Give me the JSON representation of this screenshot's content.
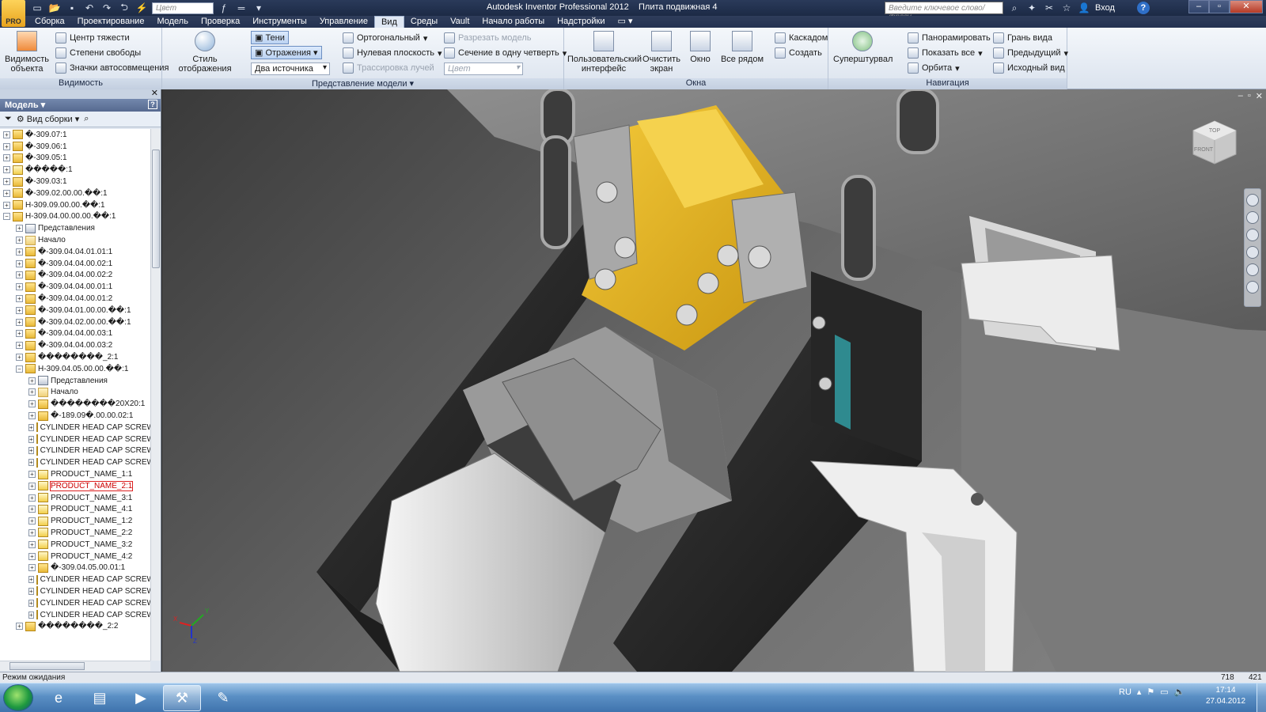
{
  "app": {
    "title": "Autodesk Inventor Professional 2012",
    "document": "Плита подвижная 4",
    "logo_text": "PRO"
  },
  "qat": {
    "color_combo": "Цвет"
  },
  "helpbar": {
    "search_placeholder": "Введите ключевое слово/фразу",
    "login": "Вход",
    "help": "?"
  },
  "menu": {
    "tabs": [
      "Сборка",
      "Проектирование",
      "Модель",
      "Проверка",
      "Инструменты",
      "Управление",
      "Вид",
      "Среды",
      "Vault",
      "Начало работы",
      "Надстройки"
    ],
    "active": "Вид"
  },
  "ribbon": {
    "visibility": {
      "label": "Видимость",
      "big": "Видимость объекта",
      "items": [
        "Центр тяжести",
        "Степени свободы",
        "Значки автосовмещения"
      ]
    },
    "appearance": {
      "label": "Представление модели",
      "style": "Стиль отображения",
      "shadows": "Тени",
      "reflections": "Отражения",
      "lights": "Два источника",
      "ortho": "Ортогональный",
      "ground": "Нулевая плоскость",
      "raytrace": "Трассировка лучей",
      "cut": "Разрезать модель",
      "quarter": "Сечение в одну четверть",
      "color": "Цвет"
    },
    "windows": {
      "label": "Окна",
      "ui": "Пользовательский интерфейс",
      "clean": "Очистить экран",
      "window": "Окно",
      "tile": "Все рядом",
      "cascade": "Каскадом",
      "new": "Создать"
    },
    "navigation": {
      "label": "Навигация",
      "wheel": "Суперштурвал",
      "pan": "Панорамировать",
      "zoomall": "Показать все",
      "orbit": "Орбита",
      "face": "Грань вида",
      "prev": "Предыдущий",
      "home": "Исходный вид"
    }
  },
  "browser": {
    "title": "Модель",
    "view": "Вид сборки",
    "nodes": [
      {
        "d": 0,
        "t": "�-309.07:1",
        "i": "asm",
        "e": "+"
      },
      {
        "d": 0,
        "t": "�-309.06:1",
        "i": "asm",
        "e": "+"
      },
      {
        "d": 0,
        "t": "�-309.05:1",
        "i": "asm",
        "e": "+"
      },
      {
        "d": 0,
        "t": "�����:1",
        "i": "part",
        "e": "+"
      },
      {
        "d": 0,
        "t": "�-309.03:1",
        "i": "asm",
        "e": "+"
      },
      {
        "d": 0,
        "t": "�-309.02.00.00.��:1",
        "i": "asm",
        "e": "+"
      },
      {
        "d": 0,
        "t": "H-309.09.00.00.��:1",
        "i": "asm",
        "e": "+"
      },
      {
        "d": 0,
        "t": "H-309.04.00.00.00.��:1",
        "i": "asm",
        "e": "−"
      },
      {
        "d": 1,
        "t": "Представления",
        "i": "view",
        "e": "+"
      },
      {
        "d": 1,
        "t": "Начало",
        "i": "folder",
        "e": "+"
      },
      {
        "d": 1,
        "t": "�-309.04.04.01.01:1",
        "i": "asm",
        "e": "+"
      },
      {
        "d": 1,
        "t": "�-309.04.04.00.02:1",
        "i": "asm",
        "e": "+"
      },
      {
        "d": 1,
        "t": "�-309.04.04.00.02:2",
        "i": "asm",
        "e": "+"
      },
      {
        "d": 1,
        "t": "�-309.04.04.00.01:1",
        "i": "asm",
        "e": "+"
      },
      {
        "d": 1,
        "t": "�-309.04.04.00.01:2",
        "i": "asm",
        "e": "+"
      },
      {
        "d": 1,
        "t": "�-309.04.01.00.00.��:1",
        "i": "asm",
        "e": "+"
      },
      {
        "d": 1,
        "t": "�-309.04.02.00.00.��:1",
        "i": "asm",
        "e": "+"
      },
      {
        "d": 1,
        "t": "�-309.04.04.00.03:1",
        "i": "asm",
        "e": "+"
      },
      {
        "d": 1,
        "t": "�-309.04.04.00.03:2",
        "i": "asm",
        "e": "+"
      },
      {
        "d": 1,
        "t": "��������_2:1",
        "i": "asm",
        "e": "+"
      },
      {
        "d": 1,
        "t": "H-309.04.05.00.00.��:1",
        "i": "asm",
        "e": "−"
      },
      {
        "d": 2,
        "t": "Представления",
        "i": "view",
        "e": "+"
      },
      {
        "d": 2,
        "t": "Начало",
        "i": "folder",
        "e": "+"
      },
      {
        "d": 2,
        "t": "��������20X20:1",
        "i": "asm",
        "e": "+"
      },
      {
        "d": 2,
        "t": "�-189.09�.00.00.02:1",
        "i": "asm",
        "e": "+"
      },
      {
        "d": 2,
        "t": "CYLINDER HEAD CAP SCREW",
        "i": "part",
        "e": "+"
      },
      {
        "d": 2,
        "t": "CYLINDER HEAD CAP SCREW",
        "i": "part",
        "e": "+"
      },
      {
        "d": 2,
        "t": "CYLINDER HEAD CAP SCREW",
        "i": "part",
        "e": "+"
      },
      {
        "d": 2,
        "t": "CYLINDER HEAD CAP SCREW",
        "i": "part",
        "e": "+"
      },
      {
        "d": 2,
        "t": "PRODUCT_NAME_1:1",
        "i": "part",
        "e": "+"
      },
      {
        "d": 2,
        "t": "PRODUCT_NAME_2:1",
        "i": "part",
        "e": "+",
        "sel": true
      },
      {
        "d": 2,
        "t": "PRODUCT_NAME_3:1",
        "i": "part",
        "e": "+"
      },
      {
        "d": 2,
        "t": "PRODUCT_NAME_4:1",
        "i": "part",
        "e": "+"
      },
      {
        "d": 2,
        "t": "PRODUCT_NAME_1:2",
        "i": "part",
        "e": "+"
      },
      {
        "d": 2,
        "t": "PRODUCT_NAME_2:2",
        "i": "part",
        "e": "+"
      },
      {
        "d": 2,
        "t": "PRODUCT_NAME_3:2",
        "i": "part",
        "e": "+"
      },
      {
        "d": 2,
        "t": "PRODUCT_NAME_4:2",
        "i": "part",
        "e": "+"
      },
      {
        "d": 2,
        "t": "�-309.04.05.00.01:1",
        "i": "asm",
        "e": "+"
      },
      {
        "d": 2,
        "t": "CYLINDER HEAD CAP SCREW",
        "i": "part",
        "e": "+"
      },
      {
        "d": 2,
        "t": "CYLINDER HEAD CAP SCREW",
        "i": "part",
        "e": "+"
      },
      {
        "d": 2,
        "t": "CYLINDER HEAD CAP SCREW",
        "i": "part",
        "e": "+"
      },
      {
        "d": 2,
        "t": "CYLINDER HEAD CAP SCREW",
        "i": "part",
        "e": "+"
      },
      {
        "d": 1,
        "t": "��������_2:2",
        "i": "asm",
        "e": "+"
      }
    ]
  },
  "viewport": {
    "triad": {
      "x": "X",
      "y": "Y",
      "z": "Z"
    }
  },
  "status": {
    "text": "Режим ожидания",
    "x": "718",
    "y": "421"
  },
  "taskbar": {
    "lang": "RU",
    "time": "17:14",
    "date": "27.04.2012"
  },
  "colors": {
    "accent_yellow": "#e9b51a",
    "title_bar": "#1c2a45",
    "ribbon": "#dbe3ee",
    "teal_part": "#2f8a8f"
  }
}
